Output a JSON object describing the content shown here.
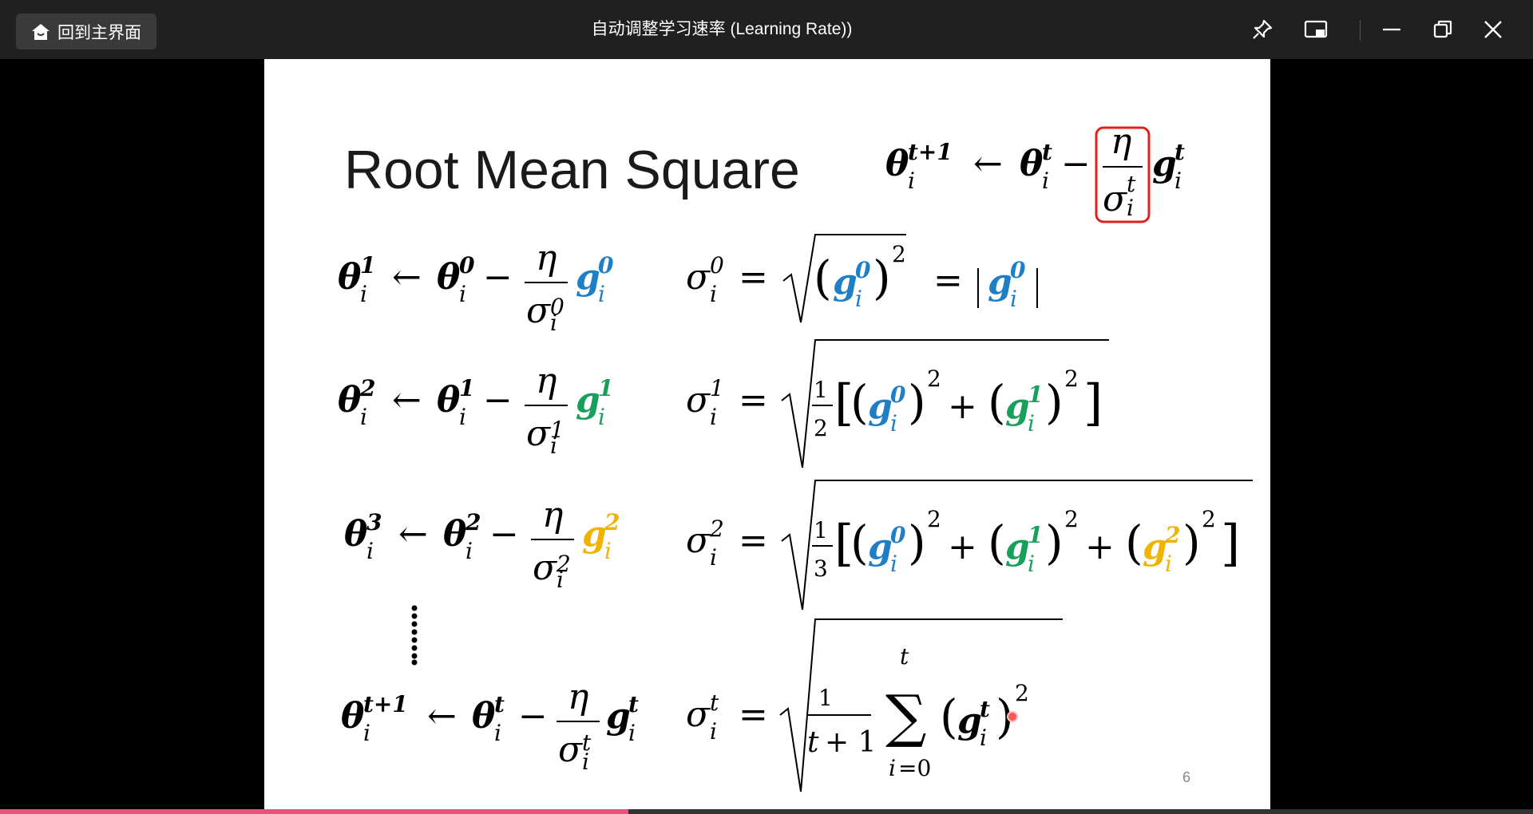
{
  "window": {
    "home_button_label": "回到主界面",
    "title": "自动调整学习速率 (Learning Rate))",
    "icons": [
      "home-icon",
      "pin-icon",
      "picture-in-picture-icon",
      "minimize-icon",
      "restore-icon",
      "close-icon"
    ]
  },
  "slide": {
    "title": "Root Mean Square",
    "page_number": "6",
    "colors": {
      "g0": "#1e7fc6",
      "g1": "#16a05a",
      "g2": "#f0b400",
      "highlight": "#e0201b"
    }
  },
  "player": {
    "progress_fraction": 0.41
  }
}
